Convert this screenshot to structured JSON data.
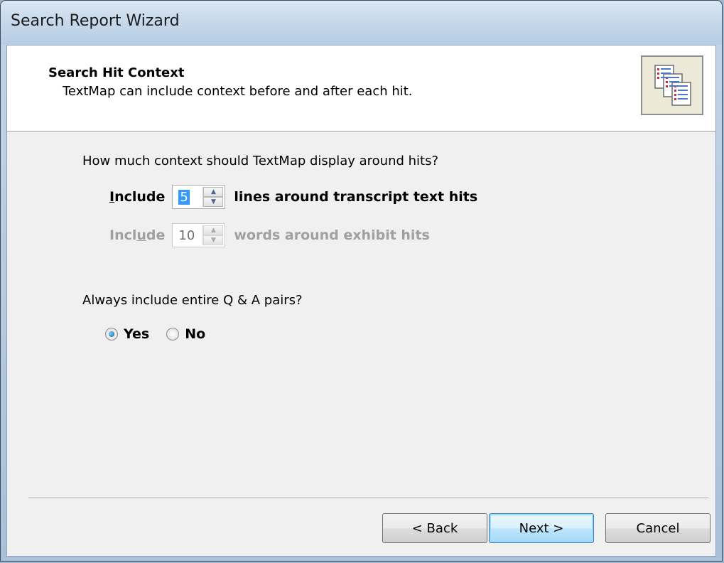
{
  "window": {
    "title": "Search Report Wizard"
  },
  "header": {
    "title": "Search Hit Context",
    "subtitle": "TextMap can include context before and after each hit.",
    "icon": "report-pages-icon"
  },
  "context": {
    "question": "How much context should TextMap display around hits?",
    "lines": {
      "prefix": "Include",
      "value": "5",
      "suffix": "lines around transcript text hits",
      "enabled": true
    },
    "words": {
      "prefix_a": "Incl",
      "prefix_u": "u",
      "prefix_b": "de",
      "value": "10",
      "suffix": "words around exhibit hits",
      "enabled": false
    }
  },
  "qa": {
    "question": "Always include entire Q & A pairs?",
    "options": [
      {
        "label": "Yes",
        "selected": true
      },
      {
        "label": "No",
        "selected": false
      }
    ]
  },
  "buttons": {
    "back": "< Back",
    "next": "Next >",
    "cancel": "Cancel"
  }
}
